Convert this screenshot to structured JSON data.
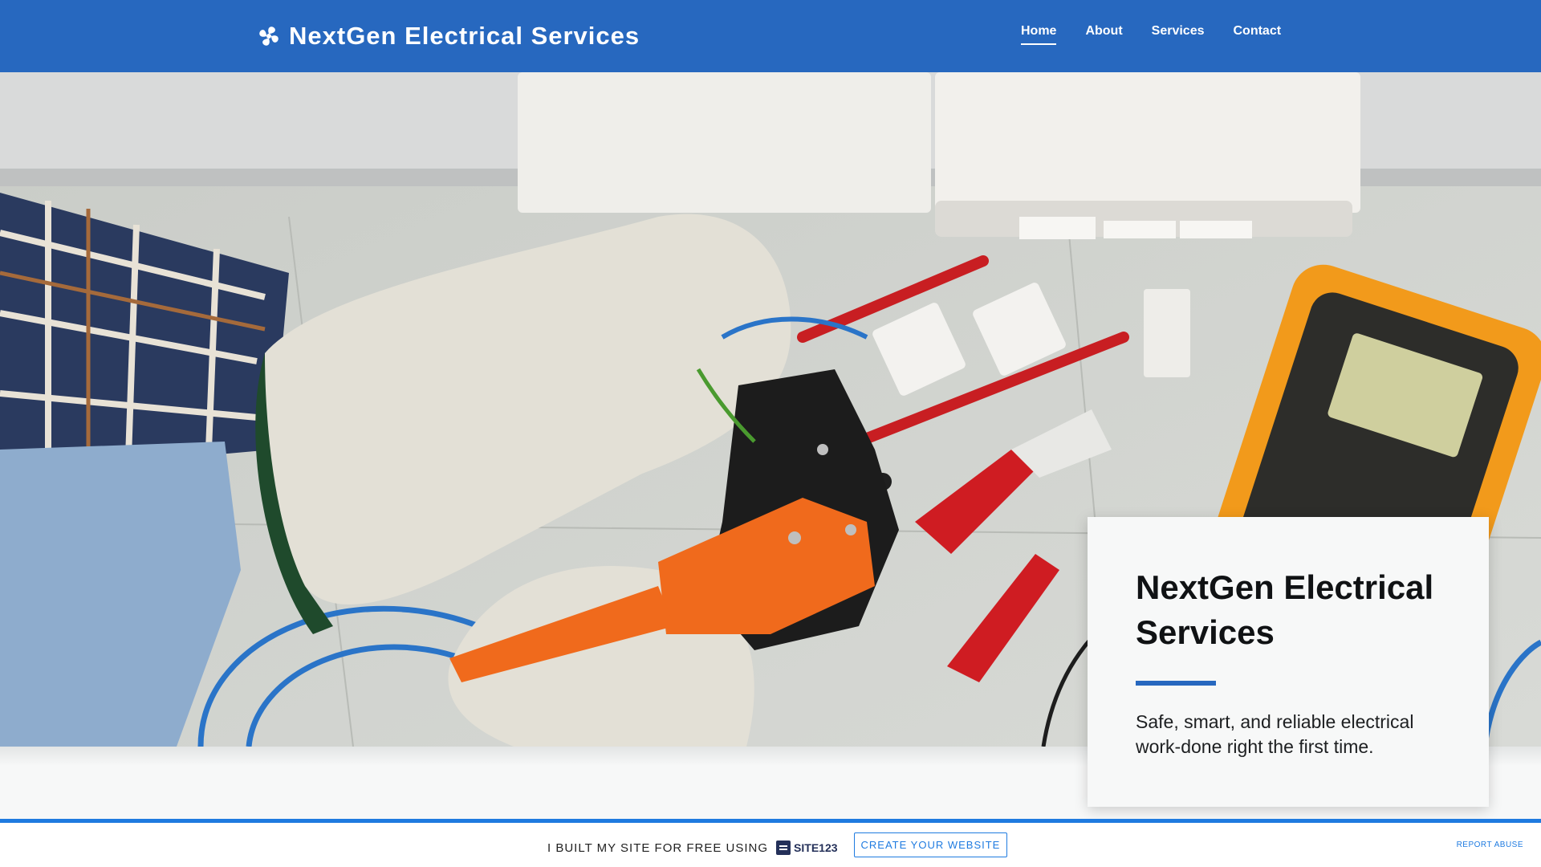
{
  "header": {
    "brand_name": "NextGen Electrical Services",
    "nav": [
      {
        "label": "Home",
        "active": true
      },
      {
        "label": "About",
        "active": false
      },
      {
        "label": "Services",
        "active": false
      },
      {
        "label": "Contact",
        "active": false
      }
    ]
  },
  "hero": {
    "image": "electrician-gloved-hands-stripping-wire-with-tools-and-multimeter",
    "card": {
      "title": "NextGen Electrical Services",
      "subtitle": "Safe, smart, and reliable electrical work-done right the first time."
    }
  },
  "footer": {
    "promo_text": "I BUILT MY SITE FOR FREE USING",
    "logo_text": "SITE123",
    "create_button": "CREATE YOUR WEBSITE",
    "report_link": "REPORT ABUSE"
  },
  "colors": {
    "brand_blue": "#2768bf",
    "footer_accent": "#1f7be0",
    "page_bg": "#f7f8f8"
  }
}
